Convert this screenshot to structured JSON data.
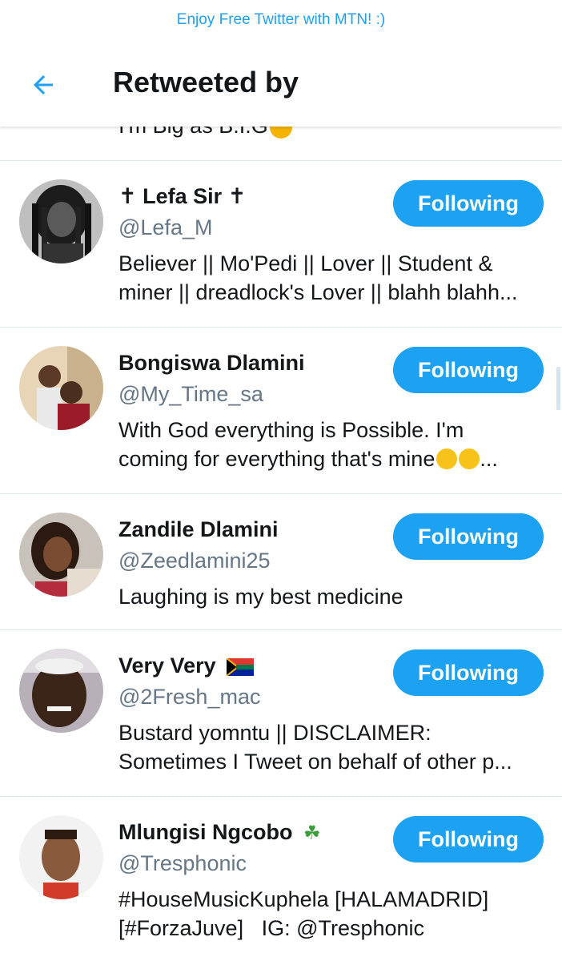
{
  "promo": {
    "text": "Enjoy Free Twitter with MTN! :)"
  },
  "header": {
    "title": "Retweeted by",
    "back_icon": "arrow-left-icon"
  },
  "colors": {
    "accent": "#1da1f2",
    "text": "#14171a",
    "secondary": "#657786",
    "divider": "#e1e8ed"
  },
  "partial_row": {
    "bio": "I'm Big as B.I.G"
  },
  "users": [
    {
      "name": "Lefa Sir",
      "name_prefix": "✝",
      "name_suffix": "✝",
      "handle": "@Lefa_M",
      "bio_lines": [
        "Believer || Mo'Pedi || Lover || Student &",
        "miner || dreadlock's Lover || blahh blahh..."
      ],
      "button": "Following"
    },
    {
      "name": "Bongiswa Dlamini",
      "handle": "@My_Time_sa",
      "bio_lines": [
        "With God everything is Possible. I'm",
        "coming for everything that's mine"
      ],
      "bio_ellipsis": "...",
      "button": "Following"
    },
    {
      "name": "Zandile Dlamini",
      "handle": "@Zeedlamini25",
      "bio_lines": [
        "Laughing is my best medicine"
      ],
      "button": "Following"
    },
    {
      "name": "Very Very",
      "name_icon": "south-africa-flag-icon",
      "handle": "@2Fresh_mac",
      "bio_lines": [
        "Bustard yomntu || DISCLAIMER:",
        "Sometimes I Tweet on behalf of other p..."
      ],
      "button": "Following"
    },
    {
      "name": "Mlungisi Ngcobo",
      "name_icon": "shamrock-icon",
      "handle": "@Tresphonic",
      "bio_lines": [
        "#HouseMusicKuphela [HALAMADRID]",
        "[#ForzaJuve]   IG: @Tresphonic"
      ],
      "button": "Following"
    }
  ]
}
